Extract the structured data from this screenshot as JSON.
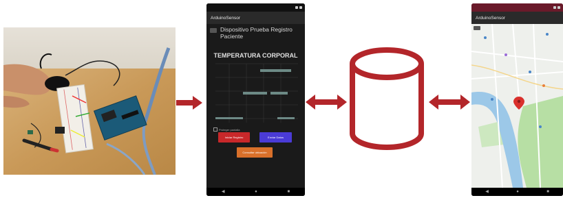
{
  "colors": {
    "arrow": "#b3262a",
    "cylinder": "#b3262a"
  },
  "phone_app": {
    "app_title": "ArduinoSensor",
    "device_title": "Dispositivo Prueba Registro Paciente",
    "section_title": "TEMPERATURA CORPORAL",
    "checkbox_label": "Proteger pantalla",
    "buttons": [
      {
        "label": "Iniciar Registro",
        "color": "#c8282a"
      },
      {
        "label": "Enviar Datos",
        "color": "#4a3bd6"
      },
      {
        "label": "Consultar ubicación",
        "color": "#d9702a"
      }
    ],
    "nav_icons": [
      "back-icon",
      "home-icon",
      "recents-icon"
    ]
  },
  "map_app": {
    "app_title": "ArduinoSensor",
    "marker_color": "#d9302c"
  },
  "database": {
    "icon": "database-cylinder-icon"
  }
}
